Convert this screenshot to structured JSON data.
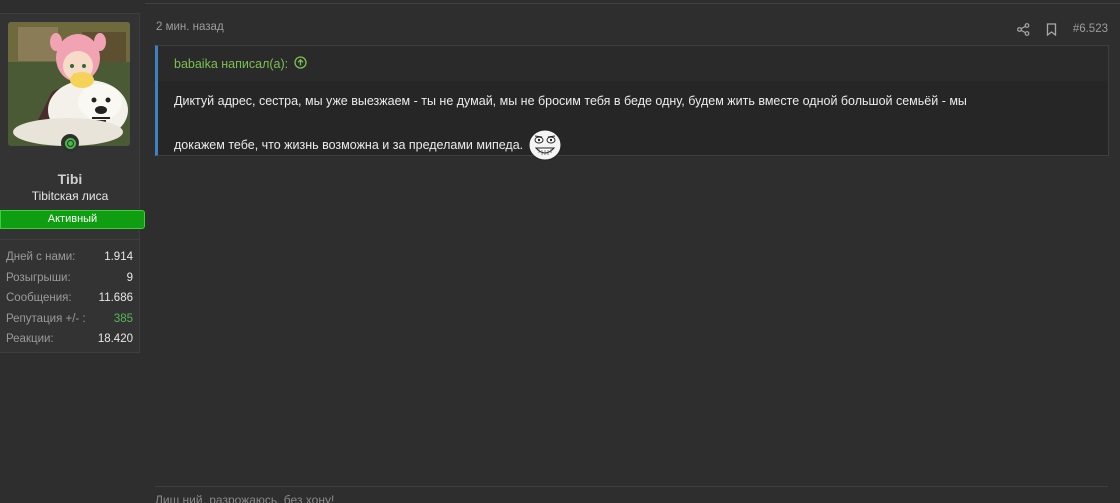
{
  "user": {
    "name": "Tibi",
    "title": "Tibіtская лиса",
    "status": "Активный",
    "online": true,
    "stats": [
      {
        "label": "Дней с нами:",
        "value": "1.914"
      },
      {
        "label": "Розыгрыши:",
        "value": "9"
      },
      {
        "label": "Сообщения:",
        "value": "11.686"
      },
      {
        "label": "Репутация +/- :",
        "value": "385"
      },
      {
        "label": "Реакции:",
        "value": "18.420"
      }
    ]
  },
  "post": {
    "time": "2 мин. назад",
    "number": "#6.523",
    "icons": [
      "share-icon",
      "bookmark-icon"
    ],
    "quote": {
      "author_line": "babaika написал(а):",
      "line1": "Диктуй адрес, сестра, мы уже выезжаем - ты не думай, мы не бросим тебя в беде одну, будем жить вместе одной большой семьёй - мы",
      "line2": "докажем тебе, что жизнь возможна и за пределами мипеда."
    },
    "signature": "Лиш ний, разрожаюсь, без хону!"
  },
  "colors": {
    "background": "#2e2e2e",
    "accent_green": "#0f9d12",
    "quote_border": "#3d83c4",
    "quote_author": "#7cbf52"
  }
}
